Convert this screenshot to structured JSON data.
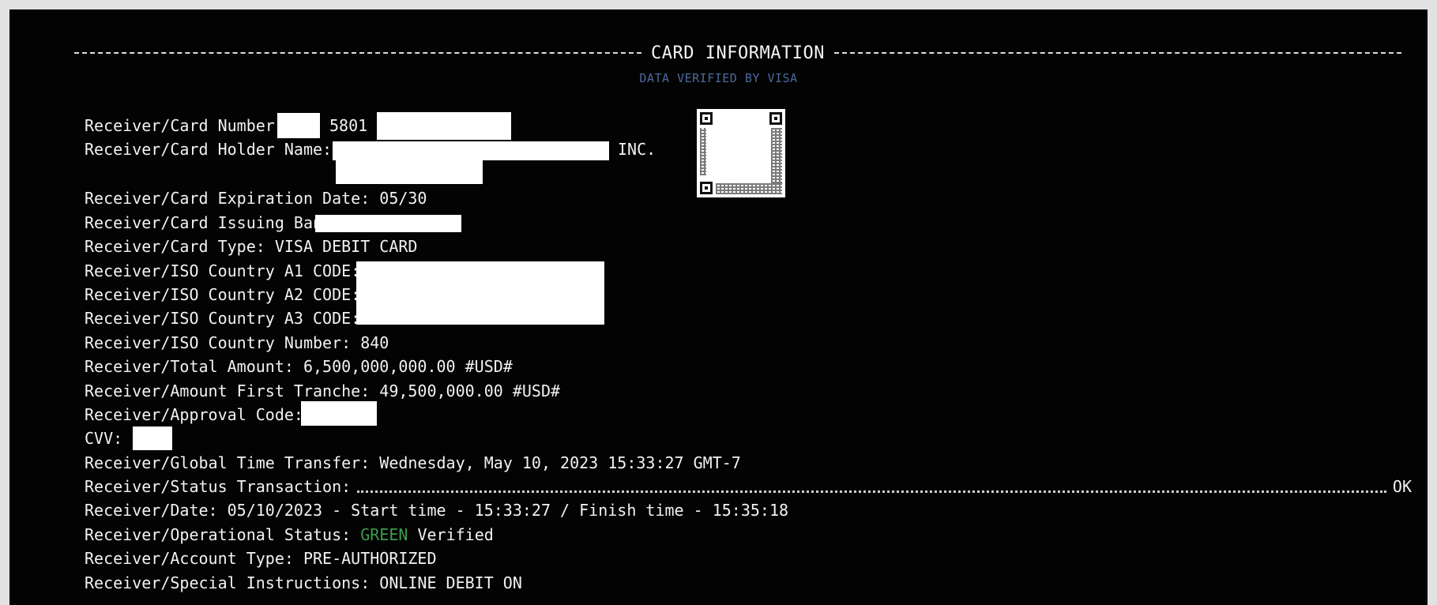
{
  "header": {
    "title": "CARD INFORMATION",
    "subtitle": "DATA VERIFIED BY VISA"
  },
  "fields": {
    "card_number_label": "Receiver/Card Number:",
    "card_number_partial": "5801",
    "holder_name_label": "Receiver/Card Holder Name:",
    "holder_name_suffix": "INC.",
    "expiration": "Receiver/Card Expiration Date: 05/30",
    "issuing_bank_label": "Receiver/Card Issuing Bank:",
    "card_type": "Receiver/Card Type: VISA DEBIT CARD",
    "iso_a1_label": "Receiver/ISO Country A1 CODE:",
    "iso_a2_label": "Receiver/ISO Country A2 CODE:",
    "iso_a3_label": "Receiver/ISO Country A3 CODE:",
    "iso_number": "Receiver/ISO Country Number: 840",
    "total_amount": "Receiver/Total Amount: 6,500,000,000.00 #USD#",
    "first_tranche": "Receiver/Amount First Tranche: 49,500,000.00 #USD#",
    "approval_code_label": "Receiver/Approval Code:",
    "cvv_label": "CVV:",
    "global_time": "Receiver/Global Time Transfer: Wednesday, May 10, 2023 15:33:27 GMT-7",
    "status_label": "Receiver/Status Transaction:",
    "status_value": "OK",
    "date_line": "Receiver/Date: 05/10/2023 - Start time - 15:33:27 / Finish time - 15:35:18",
    "operational_label": "Receiver/Operational Status:",
    "operational_green": "GREEN",
    "operational_value": "Verified",
    "account_type": "Receiver/Account Type: PRE-AUTHORIZED",
    "special_instructions": "Receiver/Special Instructions: ONLINE DEBIT ON"
  }
}
